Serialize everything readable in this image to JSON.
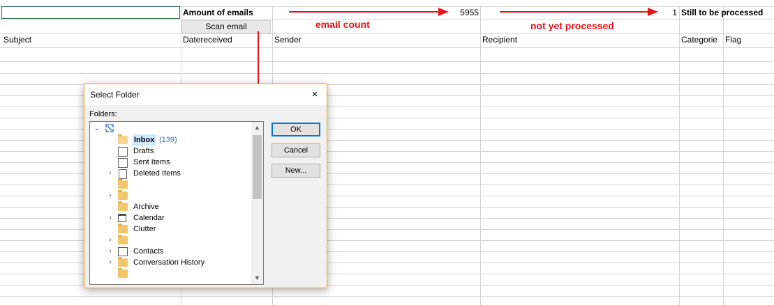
{
  "sheet": {
    "row1": {
      "amount_label": "Amount of emails",
      "count_value": "5955",
      "processed_value": "1",
      "still_label": "Still to be processed"
    },
    "scan_button": "Scan email",
    "annotations": {
      "email_count": "email count",
      "not_processed": "not yet processed"
    },
    "headers": [
      "Subject",
      "Datereceived",
      "Sender",
      "Recipient",
      "Categorie",
      "Flag"
    ]
  },
  "dialog": {
    "title": "Select Folder",
    "close_icon": "×",
    "folders_label": "Folders:",
    "tree": [
      {
        "label": "Inbox",
        "count": "(139)"
      },
      {
        "label": "Drafts"
      },
      {
        "label": "Sent Items"
      },
      {
        "label": "Deleted Items"
      },
      {
        "label": ""
      },
      {
        "label": "Archive"
      },
      {
        "label": "Calendar"
      },
      {
        "label": "Clutter"
      },
      {
        "label": ""
      },
      {
        "label": "Contacts"
      },
      {
        "label": "Conversation History"
      },
      {
        "label": ""
      }
    ],
    "buttons": {
      "ok": "OK",
      "cancel": "Cancel",
      "new": "New..."
    }
  },
  "colors": {
    "accent_red": "#e8141c",
    "excel_green": "#217346"
  }
}
